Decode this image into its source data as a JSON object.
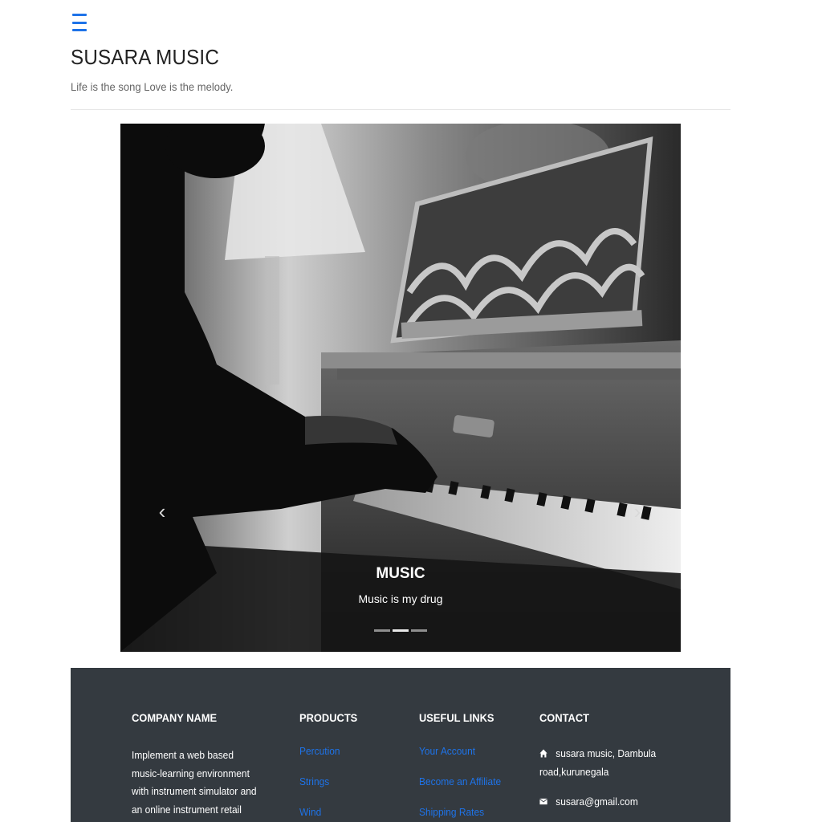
{
  "header": {
    "menu_icon": "hamburger-icon",
    "title": "SUSARA MUSIC",
    "tagline": "Life is the song Love is the melody."
  },
  "carousel": {
    "caption_title": "MUSIC",
    "caption_text": "Music is my drug",
    "prev_icon": "chevron-left-icon",
    "next_icon": "chevron-right-icon",
    "slide_count": 3,
    "active_slide": 2,
    "prev_glyph": "‹",
    "next_glyph": "›"
  },
  "footer": {
    "company": {
      "heading": "COMPANY NAME",
      "text": "Implement a web based music-learning environment with instrument simulator and an online instrument retail system. We mainly"
    },
    "products": {
      "heading": "PRODUCTS",
      "items": [
        "Percution",
        "Strings",
        "Wind"
      ]
    },
    "useful_links": {
      "heading": "USEFUL LINKS",
      "items": [
        "Your Account",
        "Become an Affiliate",
        "Shipping Rates"
      ]
    },
    "contact": {
      "heading": "CONTACT",
      "address": "susara music, Dambula road,kurunegala",
      "email": "susara@gmail.com",
      "address_icon": "home-icon",
      "email_icon": "envelope-icon"
    }
  },
  "colors": {
    "accent": "#1e73e8",
    "footer_bg": "#343a40"
  }
}
